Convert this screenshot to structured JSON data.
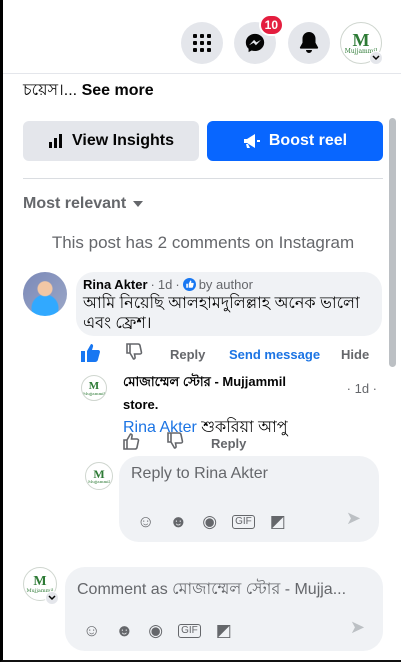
{
  "header": {
    "messenger_badge": "10"
  },
  "post": {
    "caption": "চয়েস।...",
    "see_more": "See more",
    "insights_label": "View Insights",
    "boost_label": "Boost reel"
  },
  "comments": {
    "filter": "Most relevant",
    "instagram_note": "This post has 2 comments on Instagram",
    "first": {
      "author": "Rina Akter",
      "time": "1d",
      "meta": "by author",
      "body": "আমি নিয়েছি আলহামদুলিল্লাহ অনেক ভালো এবং ফ্রেশ।",
      "reply": "Reply",
      "send": "Send message",
      "hide": "Hide"
    },
    "reply": {
      "author": "মোজাম্মেল স্টোর - Mujjammil",
      "author_suffix": "store.",
      "time": "· 1d ·",
      "mention": "Rina Akter",
      "body": "শুকরিয়া আপু",
      "reply": "Reply"
    },
    "reply_input": {
      "placeholder": "Reply to Rina Akter"
    },
    "comment_input": {
      "placeholder": "Comment as মোজাম্মেল স্টোর - Mujja..."
    }
  },
  "brand": {
    "logo_letter": "M",
    "logo_text": "Mujjammil"
  },
  "colors": {
    "primary": "#0866ff",
    "badge": "#e41e3f",
    "surface": "#f0f2f5"
  }
}
